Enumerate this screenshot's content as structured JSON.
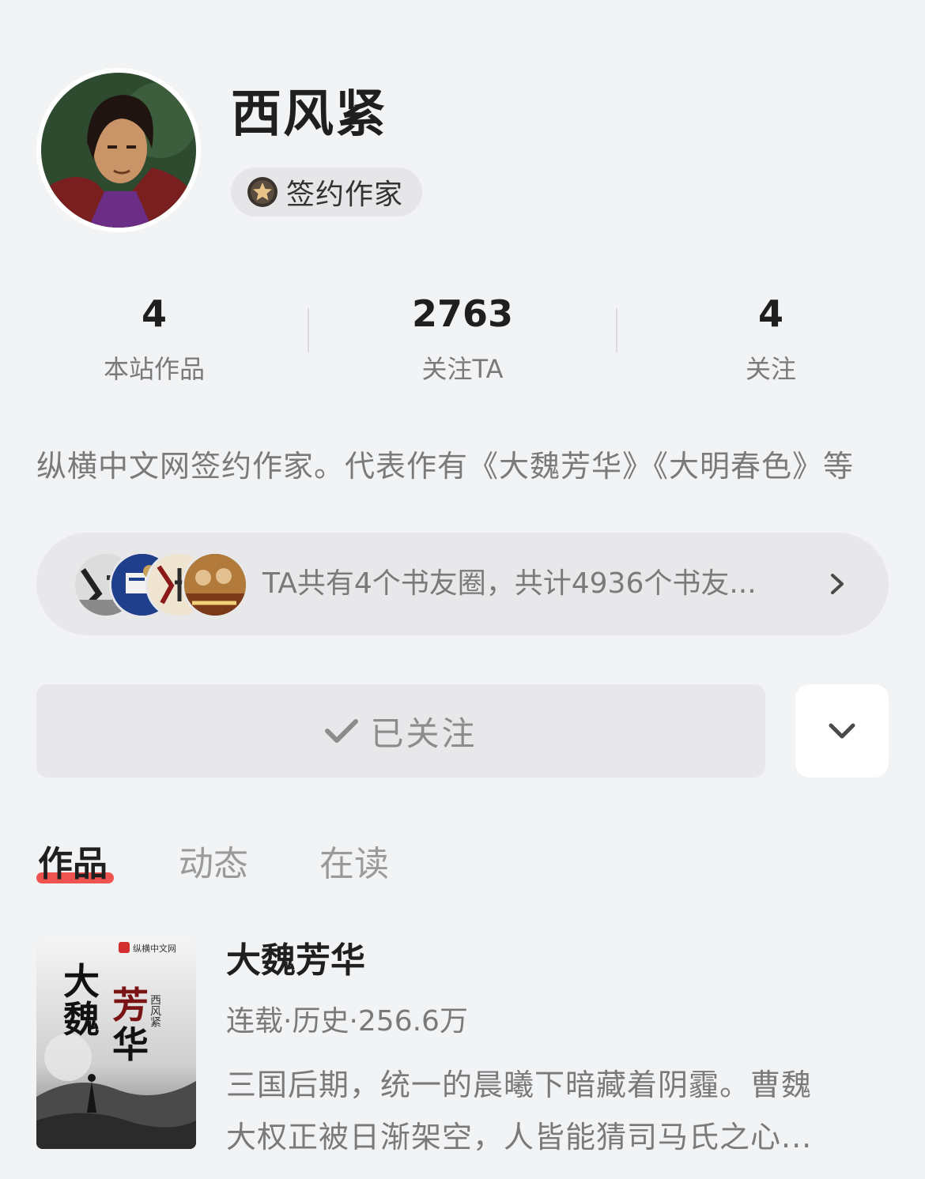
{
  "profile": {
    "name": "西风紧",
    "badge": "签约作家",
    "bio": "纵横中文网签约作家。代表作有《大魏芳华》《大明春色》等"
  },
  "stats": [
    {
      "value": "4",
      "label": "本站作品"
    },
    {
      "value": "2763",
      "label": "关注TA"
    },
    {
      "value": "4",
      "label": "关注"
    }
  ],
  "circles": {
    "text": "TA共有4个书友圈，共计4936个书友..."
  },
  "actions": {
    "follow_label": "已关注",
    "follow_icon": "check-icon",
    "more_icon": "chevron-down-icon"
  },
  "tabs": [
    {
      "label": "作品",
      "active": true
    },
    {
      "label": "动态",
      "active": false
    },
    {
      "label": "在读",
      "active": false
    }
  ],
  "books": [
    {
      "title": "大魏芳华",
      "meta": "连载·历史·256.6万",
      "desc_line1": "三国后期，统一的晨曦下暗藏着阴霾。曹魏",
      "desc_line2": "大权正被日渐架空，人皆能猜司马氏之心...",
      "cover": {
        "publisher": "纵横中文网",
        "title_chars": "大魏芳华",
        "author": "西风紧"
      }
    }
  ],
  "colors": {
    "background": "#f2f3f5",
    "accent": "#ef5350",
    "muted_text": "#7a7a7a",
    "card": "#e8e8ea"
  }
}
